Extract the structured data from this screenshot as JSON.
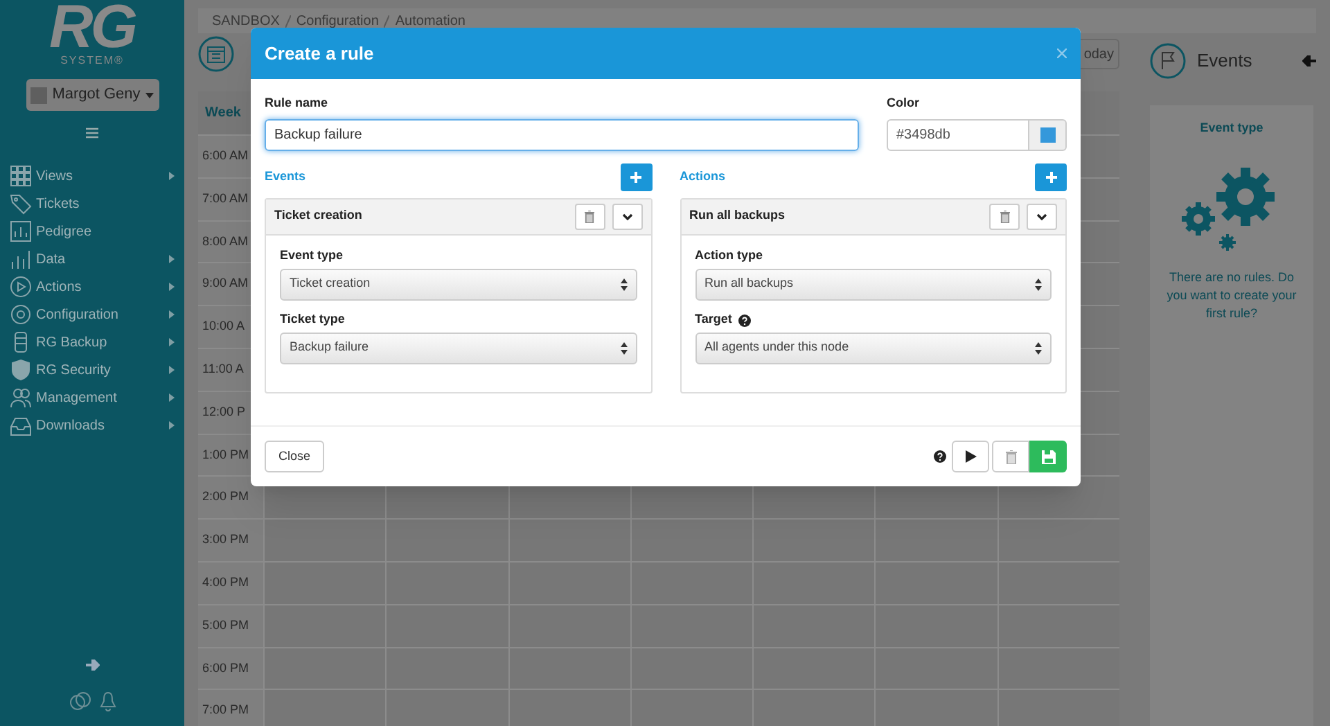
{
  "sidebar": {
    "logo": "RG",
    "logo_subtitle": "SYSTEM®",
    "user": "Margot Geny",
    "items": [
      {
        "label": "Views",
        "submenu": true
      },
      {
        "label": "Tickets",
        "submenu": false
      },
      {
        "label": "Pedigree",
        "submenu": false
      },
      {
        "label": "Data",
        "submenu": true
      },
      {
        "label": "Actions",
        "submenu": true
      },
      {
        "label": "Configuration",
        "submenu": true
      },
      {
        "label": "RG Backup",
        "submenu": true
      },
      {
        "label": "RG Security",
        "submenu": true
      },
      {
        "label": "Management",
        "submenu": true
      },
      {
        "label": "Downloads",
        "submenu": true
      }
    ]
  },
  "breadcrumb": [
    "SANDBOX",
    "Configuration",
    "Automation"
  ],
  "calendar": {
    "today_button": "oday",
    "week_label": "Week",
    "times": [
      "6:00 AM",
      "7:00 AM",
      "8:00 AM",
      "9:00 AM",
      "10:00 A",
      "11:00 A",
      "12:00 P",
      "1:00 PM",
      "2:00 PM",
      "3:00 PM",
      "4:00 PM",
      "5:00 PM",
      "6:00 PM",
      "7:00 PM"
    ]
  },
  "events_panel": {
    "title": "Events",
    "card_title": "Event type",
    "empty_message": "There are no rules. Do you want to create your first rule?"
  },
  "dialog": {
    "title": "Create a rule",
    "rule_name": {
      "label": "Rule name",
      "value": "Backup failure"
    },
    "color": {
      "label": "Color",
      "value": "#3498db"
    },
    "sections": [
      {
        "title": "Events",
        "card_title": "Ticket creation",
        "fields": [
          {
            "label": "Event type",
            "value": "Ticket creation",
            "help": false
          },
          {
            "label": "Ticket type",
            "value": "Backup failure",
            "help": false
          }
        ]
      },
      {
        "title": "Actions",
        "card_title": "Run all backups",
        "fields": [
          {
            "label": "Action type",
            "value": "Run all backups",
            "help": false
          },
          {
            "label": "Target",
            "value": "All agents under this node",
            "help": true
          }
        ]
      }
    ],
    "close_button": "Close"
  }
}
